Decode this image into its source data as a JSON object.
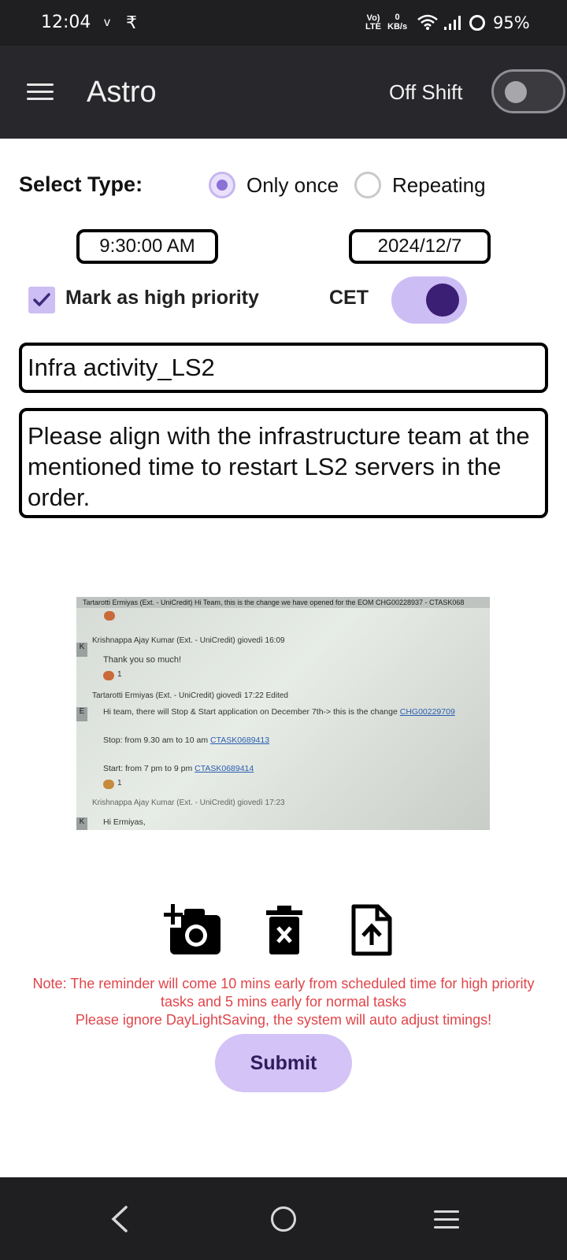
{
  "status_bar": {
    "time": "12:04",
    "indicator_v": "v",
    "indicator_k": "₹",
    "network_lte": "Vo) LTE",
    "data_rate_value": "0",
    "data_rate_unit": "KB/s",
    "battery": "95%"
  },
  "app_bar": {
    "title": "Astro",
    "shift_label": "Off Shift",
    "shift_toggle_on": false
  },
  "form": {
    "select_type_label": "Select Type:",
    "options": [
      {
        "label": "Only once",
        "selected": true
      },
      {
        "label": "Repeating",
        "selected": false
      }
    ],
    "time_value": "9:30:00 AM",
    "date_value": "2024/12/7",
    "high_priority_label": "Mark as high priority",
    "high_priority_checked": true,
    "timezone_label": "CET",
    "timezone_toggle_on": true,
    "title_value": "Infra activity_LS2",
    "description_value": "Please align with the infrastructure team at the mentioned time to restart LS2 servers in the order."
  },
  "attachment": {
    "header": "Tartarotti Ermiyas (Ext. - UniCredit)    Hi Team, this is the change we have opened for the EOM CHG00228937 - CTASK068",
    "msg1_author": "Krishnappa Ajay Kumar (Ext. - UniCredit)  giovedì 16:09",
    "msg1_text": "Thank you so much!",
    "msg2_author": "Tartarotti Ermiyas (Ext. - UniCredit)  giovedì 17:22  Edited",
    "msg2_text": "Hi team, there will Stop & Start application on December 7th-> this is the change ",
    "msg2_link": "CHG00229709",
    "stop_text": "Stop: from 9.30 am to 10 am ",
    "stop_link": "CTASK0689413",
    "start_text": "Start: from 7 pm to 9 pm ",
    "start_link": "CTASK0689414",
    "msg3_author": "Krishnappa Ajay Kumar (Ext. - UniCredit)  giovedì 17:23",
    "msg3_text": "Hi Ermiyas,",
    "reaction_count": "1",
    "avatar_k": "K",
    "avatar_e": "E"
  },
  "icons": [
    "add-photo-icon",
    "delete-image-icon",
    "upload-file-icon"
  ],
  "note": {
    "line1": "Note: The reminder will come 10 mins early from scheduled time for high priority tasks and 5 mins early for normal tasks",
    "line2": "Please ignore DayLightSaving, the system will auto adjust timings!"
  },
  "submit_label": "Submit",
  "colors": {
    "accent": "#8b70d6",
    "accent_light": "#d3c3f6",
    "note_red": "#e0454a",
    "app_bar_bg": "#28282c"
  }
}
